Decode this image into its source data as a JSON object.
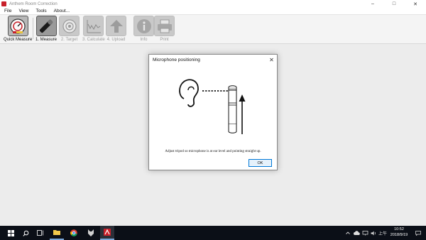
{
  "window": {
    "title": "Anthem Room Correction",
    "minimize": "–",
    "maximize": "□",
    "close": "✕"
  },
  "menu": [
    "File",
    "View",
    "Tools",
    "About..."
  ],
  "toolbar": {
    "quick_measure": "Quick Measure",
    "measure": "1. Measure",
    "target": "2. Target",
    "calculate": "3. Calculate",
    "upload": "4. Upload",
    "info": "Info",
    "print": "Print"
  },
  "dialog": {
    "title": "Microphone positioning",
    "close": "✕",
    "instruction": "Adjust tripod so microphone is at ear level and pointing straight up.",
    "ok": "OK"
  },
  "taskbar": {
    "ime": "上午",
    "time": "10:52",
    "date": "2018/9/19"
  },
  "colors": {
    "accent": "#0078d7",
    "app_icon": "#c8202a",
    "taskbar": "#0b0f17"
  }
}
